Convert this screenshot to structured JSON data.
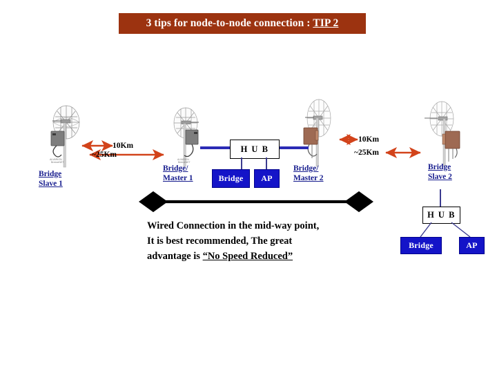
{
  "title": {
    "main": "3 tips for node-to-node connection : ",
    "emphasis": "TIP 2",
    "banner_color": "#9c3310",
    "text_color": "#ffffff"
  },
  "nodes": [
    {
      "id": "bridge-slave-1",
      "line1": "Bridge",
      "line2": "Slave 1"
    },
    {
      "id": "bridge-master-1",
      "line1": "Bridge/",
      "line2": "Master 1"
    },
    {
      "id": "bridge-master-2",
      "line1": "Bridge/",
      "line2": "Master 2"
    },
    {
      "id": "bridge-slave-2",
      "line1": "Bridge",
      "line2": "Slave 2"
    }
  ],
  "distances": {
    "left": {
      "near": "10Km",
      "far": "~25Km"
    },
    "right": {
      "near": "10Km",
      "far": "~25Km"
    }
  },
  "devices": {
    "hub_label": "H U B",
    "bridge_label": "Bridge",
    "ap_label": "AP"
  },
  "caption": {
    "line1": "Wired Connection in the mid-way point,",
    "line2": "It is best recommended, The great",
    "line3_prefix": "advantage is ",
    "line3_quote": "“No Speed Reduced”"
  },
  "colors": {
    "arrow_red": "#d2431a",
    "link_blue": "#2b2bb5",
    "box_blue": "#1414c8",
    "label_navy": "#151b8d",
    "black": "#000000"
  }
}
